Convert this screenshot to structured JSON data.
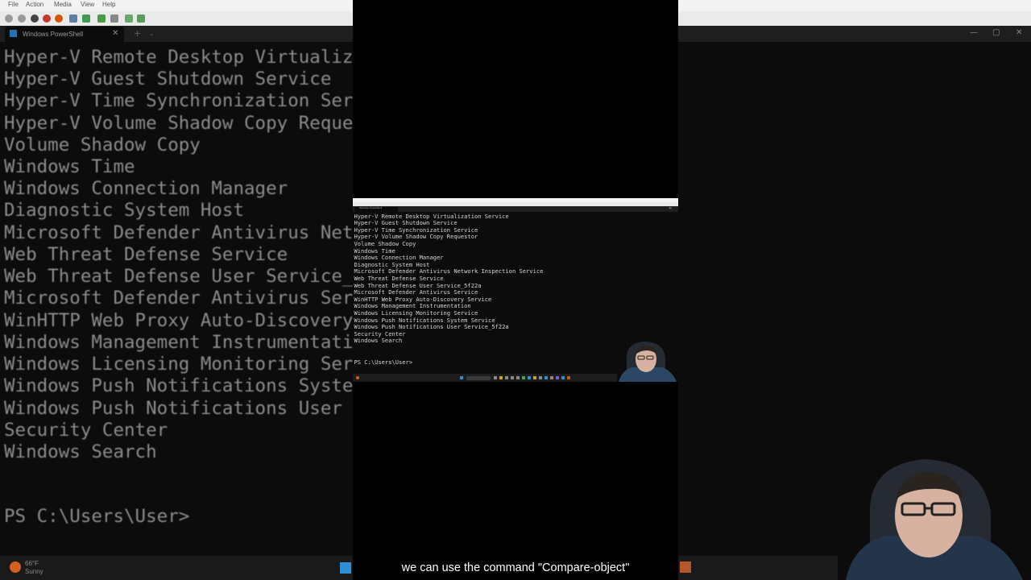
{
  "background": {
    "menu": [
      "File",
      "Action",
      "Media",
      "View",
      "Help"
    ],
    "tab_title": "Windows PowerShell",
    "weather": {
      "temp": "66°F",
      "condition": "Sunny"
    }
  },
  "terminal": {
    "lines": [
      "Hyper-V Remote Desktop Virtualization Service",
      "Hyper-V Guest Shutdown Service",
      "Hyper-V Time Synchronization Service",
      "Hyper-V Volume Shadow Copy Requestor",
      "Volume Shadow Copy",
      "Windows Time",
      "Windows Connection Manager",
      "Diagnostic System Host",
      "Microsoft Defender Antivirus Network Inspection Service",
      "Web Threat Defense Service",
      "Web Threat Defense User Service_5f22a",
      "Microsoft Defender Antivirus Service",
      "WinHTTP Web Proxy Auto-Discovery Service",
      "Windows Management Instrumentation",
      "Windows Licensing Monitoring Service",
      "Windows Push Notifications System Service",
      "Windows Push Notifications User Service_5f22a",
      "Security Center",
      "Windows Search"
    ],
    "prompt": "PS C:\\Users\\User>"
  },
  "caption": "we can use the command \"Compare-object\"",
  "colors": {
    "terminal_bg": "#0c0c0c",
    "terminal_fg": "#cccccc",
    "accent": "#2d8fd6"
  }
}
